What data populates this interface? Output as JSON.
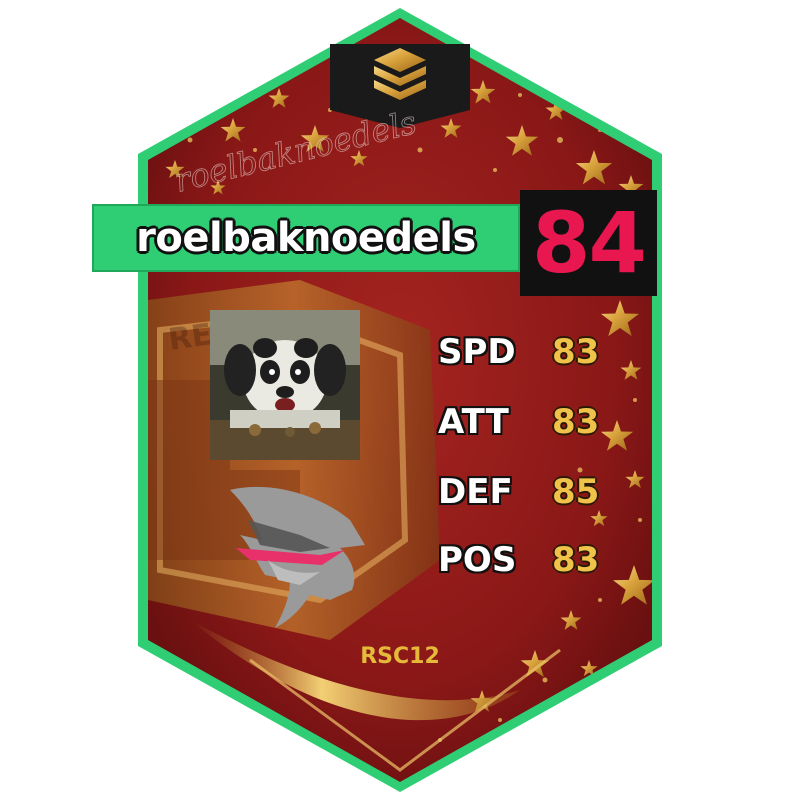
{
  "card": {
    "watermark_signature": "roelbaknoedels",
    "background_watermark": "REDE",
    "colors": {
      "frame_green": "#2fce75",
      "background_red": "#8e1b1a",
      "gold": "#e5b93a",
      "rating_red": "#e8174f",
      "team_logo_pink": "#e8306a"
    },
    "icons": {
      "top_badge": "gold-chevron-stack-icon",
      "team_logo": "eagle-head-logo-icon",
      "avatar": "panda-avatar-image"
    }
  },
  "player": {
    "name": "roelbaknoedels",
    "rating": "84"
  },
  "stats": [
    {
      "label": "SPD",
      "value": "83"
    },
    {
      "label": "ATT",
      "value": "83"
    },
    {
      "label": "DEF",
      "value": "85"
    },
    {
      "label": "POS",
      "value": "83"
    }
  ],
  "footer": {
    "series_code": "RSC12"
  }
}
